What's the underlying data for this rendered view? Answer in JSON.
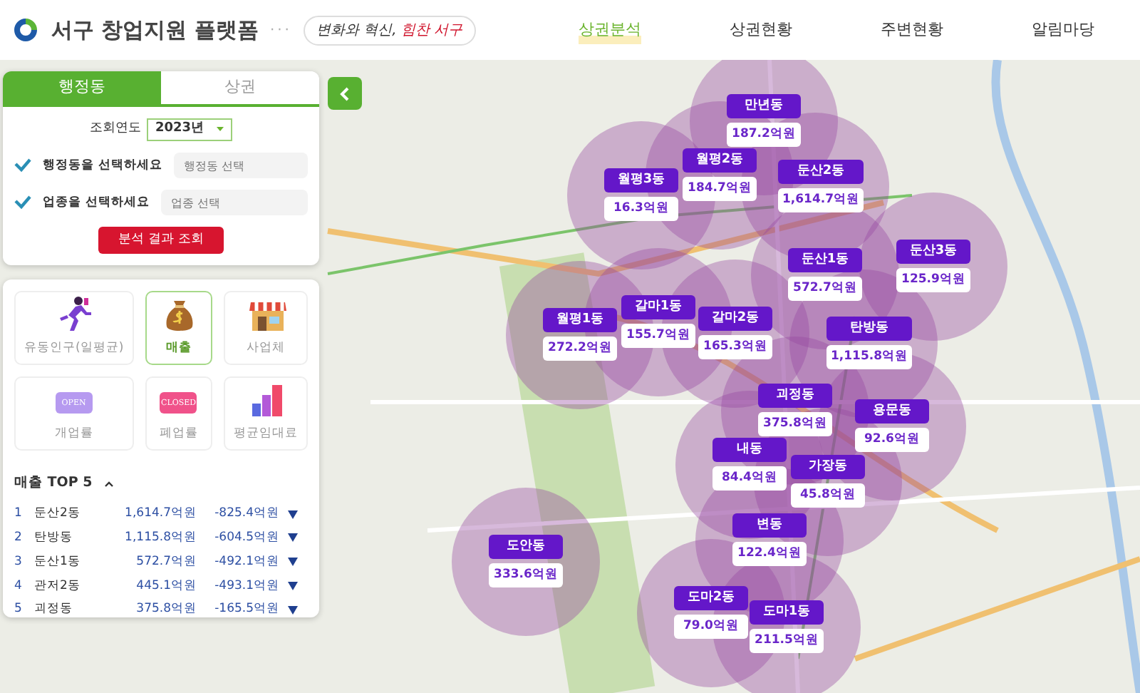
{
  "header": {
    "title": "서구 창업지원 플랫폼",
    "separator": "···",
    "slogan": {
      "main": "변화와 혁신,",
      "accent": "힘찬 서구"
    }
  },
  "nav": [
    {
      "label": "상권분석",
      "selected": true
    },
    {
      "label": "상권현황",
      "selected": false
    },
    {
      "label": "주변현황",
      "selected": false
    },
    {
      "label": "알림마당",
      "selected": false
    }
  ],
  "search_panel": {
    "tabs": [
      {
        "label": "행정동",
        "selected": true
      },
      {
        "label": "상권",
        "selected": false
      }
    ],
    "year_label": "조회연도",
    "year": "2023년",
    "filters": [
      {
        "label": "행정동을 선택하세요",
        "placeholder": "행정동 선택"
      },
      {
        "label": "업종을 선택하세요",
        "placeholder": "업종 선택"
      }
    ],
    "submit": "분석 결과 조회"
  },
  "categories": [
    {
      "label": "유동인구(일평균)",
      "kind": "runner",
      "selected": false
    },
    {
      "label": "매출",
      "kind": "moneybag",
      "selected": true
    },
    {
      "label": "사업체",
      "kind": "shop",
      "selected": false
    },
    {
      "label": "개업률",
      "kind": "open-sign",
      "sign_text": "OPEN",
      "selected": false
    },
    {
      "label": "폐업률",
      "kind": "closed-sign",
      "sign_text": "CLOSED",
      "selected": false
    },
    {
      "label": "평균임대료",
      "kind": "bar-chart",
      "selected": false
    }
  ],
  "ranking": {
    "title": "매출 TOP 5",
    "expanded": true,
    "rows": [
      {
        "rank": "1",
        "name": "둔산2동",
        "value": "1,614.7억원",
        "change": "-825.4억원"
      },
      {
        "rank": "2",
        "name": "탄방동",
        "value": "1,115.8억원",
        "change": "-604.5억원"
      },
      {
        "rank": "3",
        "name": "둔산1동",
        "value": "572.7억원",
        "change": "-492.1억원"
      },
      {
        "rank": "4",
        "name": "관저2동",
        "value": "445.1억원",
        "change": "-493.1억원"
      },
      {
        "rank": "5",
        "name": "괴정동",
        "value": "375.8억원",
        "change": "-165.5억원"
      }
    ]
  },
  "map": {
    "markers": [
      {
        "name": "만년동",
        "value": "187.2억원"
      },
      {
        "name": "월평2동",
        "value": "184.7억원"
      },
      {
        "name": "월평3동",
        "value": "16.3억원"
      },
      {
        "name": "둔산2동",
        "value": "1,614.7억원"
      },
      {
        "name": "둔산1동",
        "value": "572.7억원"
      },
      {
        "name": "둔산3동",
        "value": "125.9억원"
      },
      {
        "name": "갈마1동",
        "value": "155.7억원"
      },
      {
        "name": "월평1동",
        "value": "272.2억원"
      },
      {
        "name": "갈마2동",
        "value": "165.3억원"
      },
      {
        "name": "탄방동",
        "value": "1,115.8억원"
      },
      {
        "name": "괴정동",
        "value": "375.8억원"
      },
      {
        "name": "용문동",
        "value": "92.6억원"
      },
      {
        "name": "내동",
        "value": "84.4억원"
      },
      {
        "name": "가장동",
        "value": "45.8억원"
      },
      {
        "name": "변동",
        "value": "122.4억원"
      },
      {
        "name": "도안동",
        "value": "333.6억원"
      },
      {
        "name": "도마2동",
        "value": "79.0억원"
      },
      {
        "name": "도마1동",
        "value": "211.5억원"
      }
    ]
  }
}
